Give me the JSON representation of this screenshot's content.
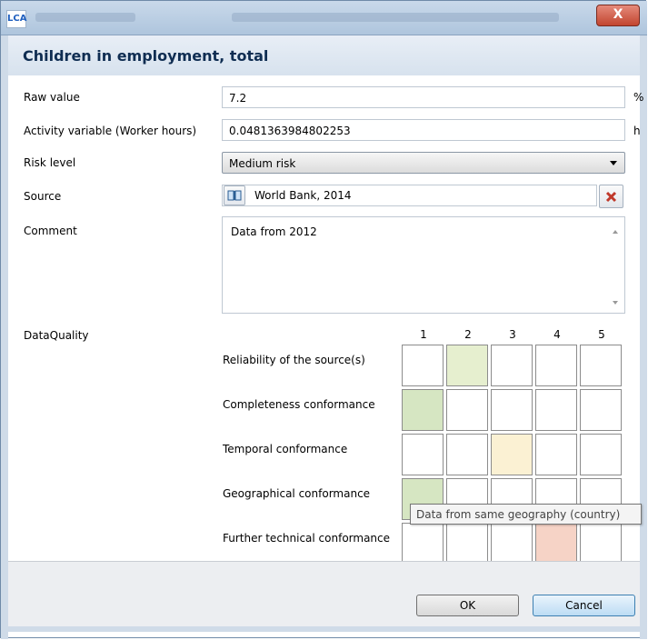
{
  "window": {
    "close_label": "X"
  },
  "header": {
    "title": "Children in employment, total"
  },
  "form": {
    "raw_value": {
      "label": "Raw value",
      "value": "7.2",
      "unit": "%"
    },
    "activity_variable": {
      "label": "Activity variable (Worker hours)",
      "value": "0.0481363984802253",
      "unit": "h"
    },
    "risk_level": {
      "label": "Risk level",
      "selected": "Medium risk"
    },
    "source": {
      "label": "Source",
      "value": "World Bank, 2014"
    },
    "comment": {
      "label": "Comment",
      "value": "Data from 2012"
    }
  },
  "data_quality": {
    "label": "DataQuality",
    "columns": [
      "1",
      "2",
      "3",
      "4",
      "5"
    ],
    "rows": [
      {
        "label": "Reliability of the source(s)",
        "selected": 2,
        "color": "#e6efcf"
      },
      {
        "label": "Completeness conformance",
        "selected": 1,
        "color": "#d6e6c2"
      },
      {
        "label": "Temporal conformance",
        "selected": 3,
        "color": "#fbf1d3"
      },
      {
        "label": "Geographical conformance",
        "selected": 1,
        "color": "#d6e6c2"
      },
      {
        "label": "Further technical conformance",
        "selected": 4,
        "color": "#f6d3c6"
      }
    ],
    "tooltip": "Data from same geography (country)"
  },
  "buttons": {
    "ok": "OK",
    "cancel": "Cancel"
  }
}
